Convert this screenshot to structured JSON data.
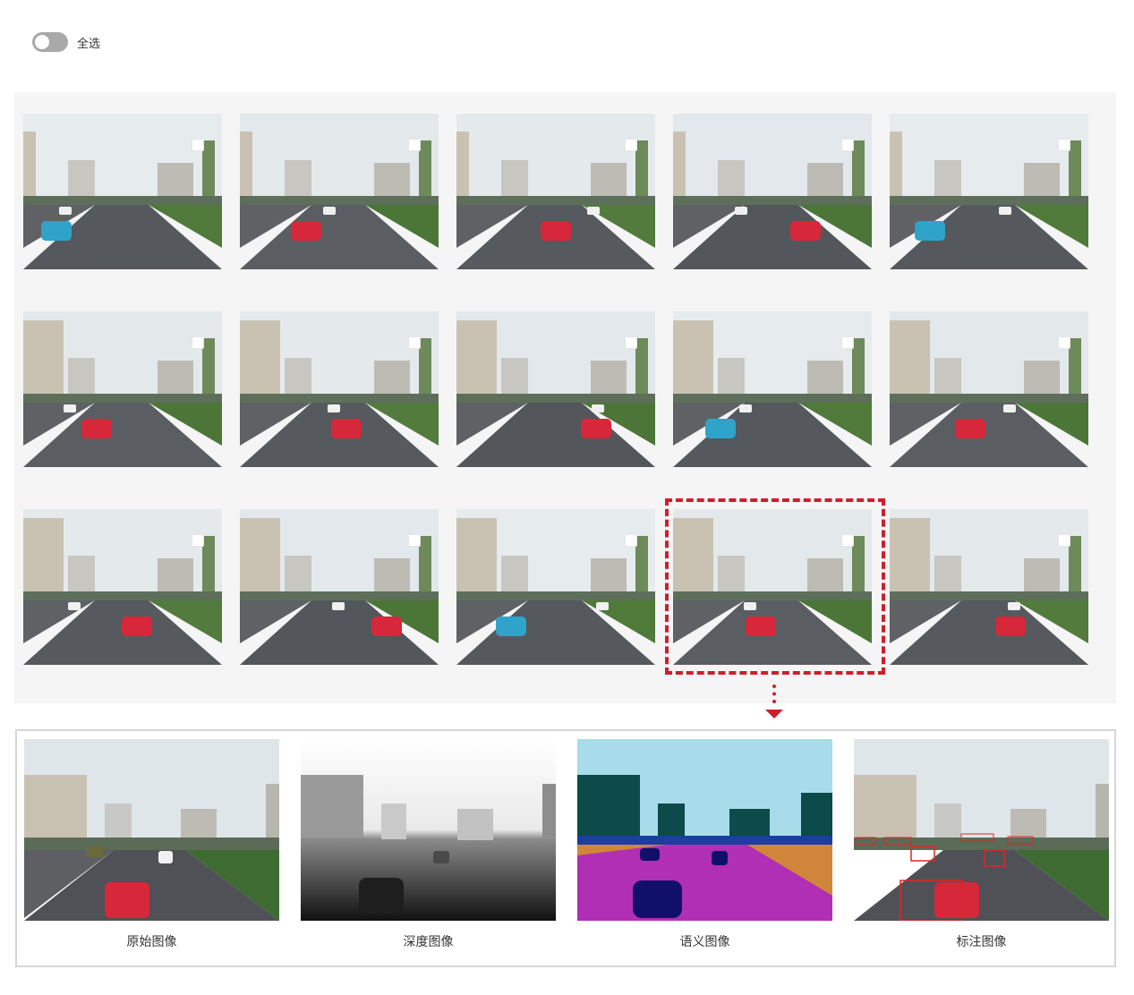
{
  "toolbar": {
    "select_all_label": "全选",
    "select_all_checked": false
  },
  "gallery": {
    "columns": 5,
    "rows": 3,
    "thumbnails": [
      {
        "id": 1,
        "selected": false
      },
      {
        "id": 2,
        "selected": false
      },
      {
        "id": 3,
        "selected": false
      },
      {
        "id": 4,
        "selected": false
      },
      {
        "id": 5,
        "selected": false
      },
      {
        "id": 6,
        "selected": false
      },
      {
        "id": 7,
        "selected": false
      },
      {
        "id": 8,
        "selected": false
      },
      {
        "id": 9,
        "selected": false
      },
      {
        "id": 10,
        "selected": false
      },
      {
        "id": 11,
        "selected": false
      },
      {
        "id": 12,
        "selected": false
      },
      {
        "id": 13,
        "selected": false
      },
      {
        "id": 14,
        "selected": false
      },
      {
        "id": 15,
        "selected": false
      }
    ],
    "highlighted_index": 14
  },
  "detail": {
    "views": [
      {
        "key": "original",
        "label": "原始图像"
      },
      {
        "key": "depth",
        "label": "深度图像"
      },
      {
        "key": "semantic",
        "label": "语义图像"
      },
      {
        "key": "annotated",
        "label": "标注图像"
      }
    ]
  },
  "colors": {
    "accent_red": "#cc1f2e",
    "panel_bg": "#f5f5f5",
    "semantic_sky": "#a8dcea",
    "semantic_building": "#0d4a4a",
    "semantic_road": "#b02fb5",
    "semantic_sidewalk": "#d0863a",
    "semantic_vehicle": "#10106a"
  }
}
